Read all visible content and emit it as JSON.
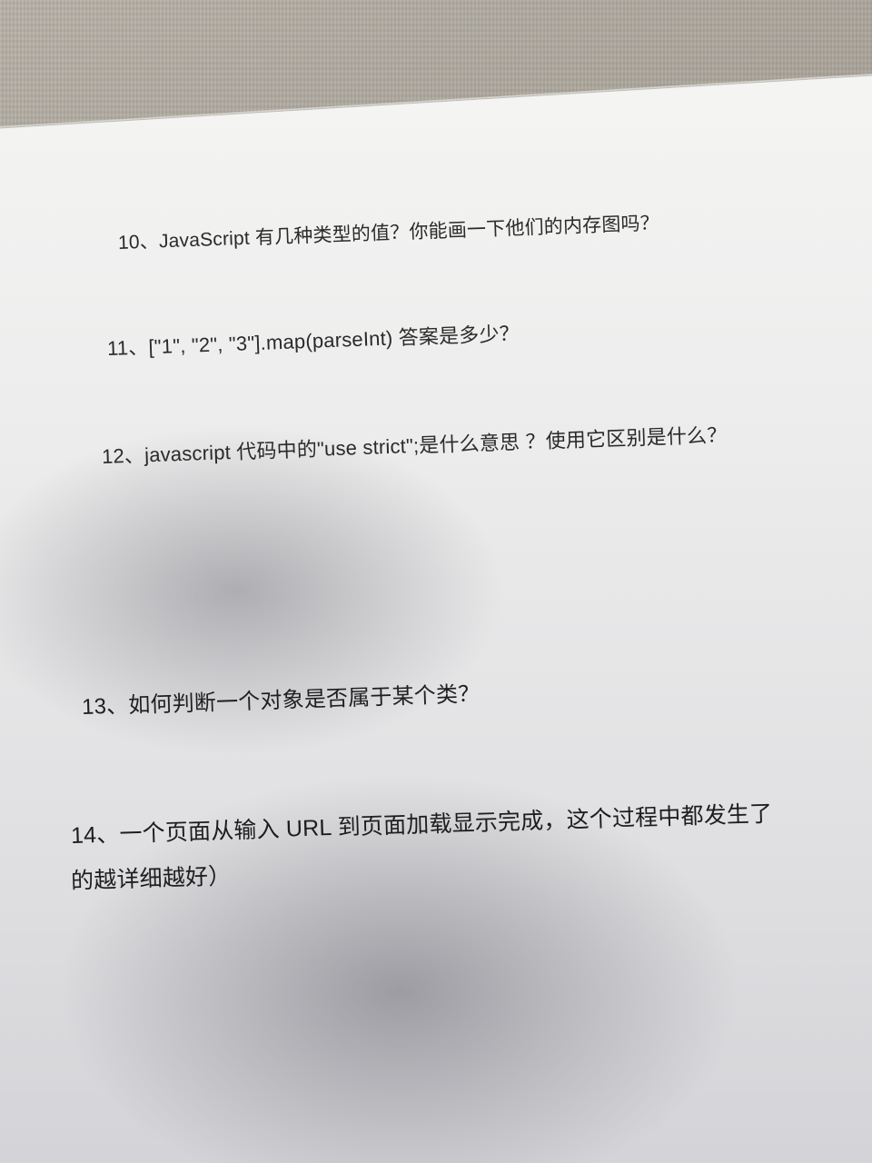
{
  "questions": [
    {
      "id": "q10",
      "text": "10、JavaScript 有几种类型的值？你能画一下他们的内存图吗？"
    },
    {
      "id": "q11",
      "text": "11、[\"1\", \"2\", \"3\"].map(parseInt)  答案是多少？"
    },
    {
      "id": "q12",
      "text": "12、javascript  代码中的\"use strict\";是什么意思 ？使用它区别是什么？"
    },
    {
      "id": "q13",
      "text": "13、如何判断一个对象是否属于某个类？"
    },
    {
      "id": "q14",
      "text": "14、一个页面从输入  URL  到页面加载显示完成，这个过程中都发生了"
    },
    {
      "id": "q14b",
      "text": "的越详细越好）"
    }
  ],
  "colors": {
    "paper": "#ededed",
    "ink": "#2a2a2a",
    "desk": "#a39d93"
  }
}
